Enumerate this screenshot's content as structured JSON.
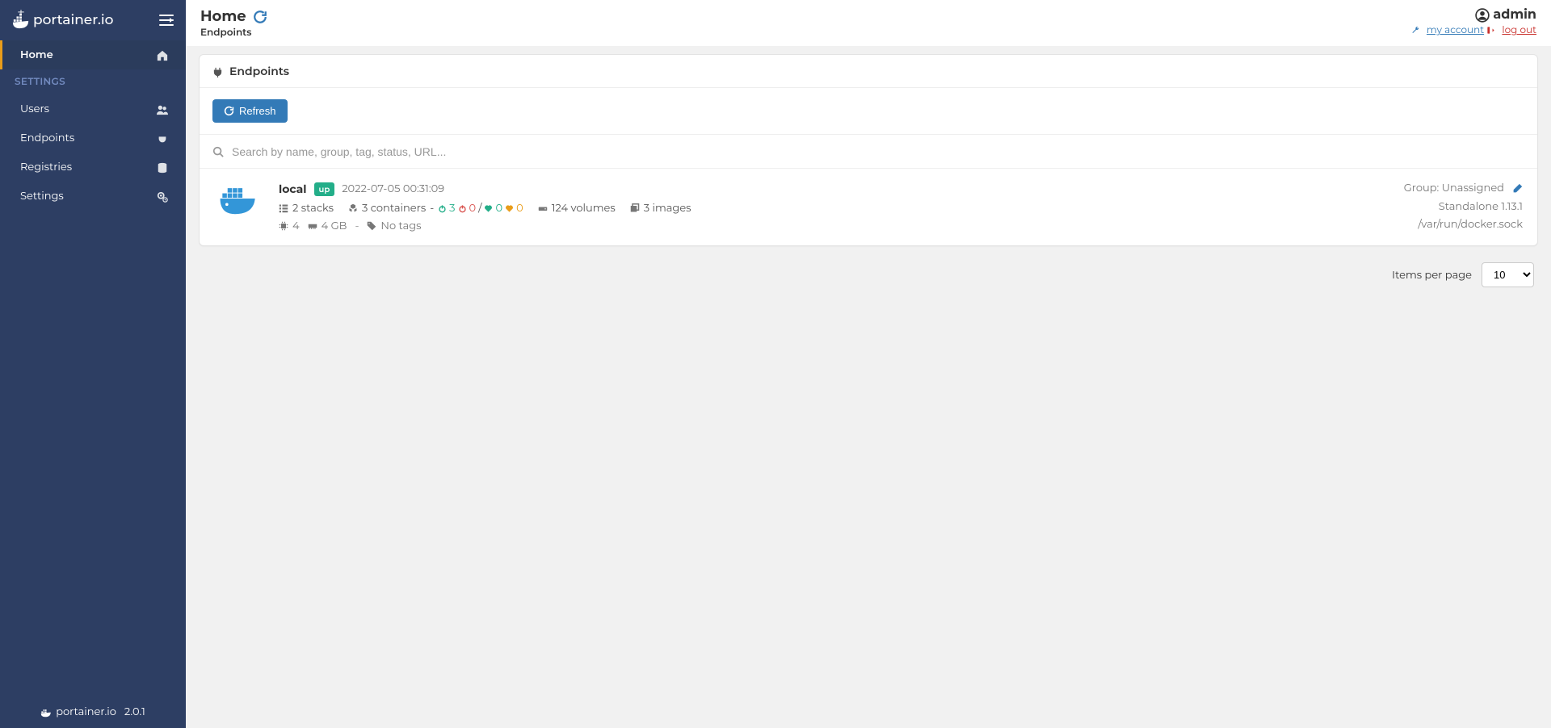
{
  "brand": "portainer.io",
  "version": "2.0.1",
  "sidebar": {
    "items": [
      {
        "label": "Home",
        "active": true
      },
      {
        "section": "SETTINGS"
      },
      {
        "label": "Users"
      },
      {
        "label": "Endpoints"
      },
      {
        "label": "Registries"
      },
      {
        "label": "Settings"
      }
    ]
  },
  "header": {
    "title": "Home",
    "subtitle": "Endpoints",
    "user": "admin",
    "my_account": "my account",
    "logout": "log out"
  },
  "panel": {
    "title": "Endpoints",
    "refresh_label": "Refresh",
    "search_placeholder": "Search by name, group, tag, status, URL..."
  },
  "endpoints": [
    {
      "name": "local",
      "status": "up",
      "date": "2022-07-05 00:31:09",
      "stacks": "2 stacks",
      "containers": "3 containers",
      "state_running": "3",
      "state_stopped": "0",
      "state_healthy": "0",
      "state_unhealthy": "0",
      "volumes": "124 volumes",
      "images": "3 images",
      "cpu": "4",
      "memory": "4 GB",
      "tags": "No tags",
      "group": "Group: Unassigned",
      "type": "Standalone 1.13.1",
      "socket": "/var/run/docker.sock"
    }
  ],
  "pagination": {
    "label": "Items per page",
    "value": "10"
  }
}
